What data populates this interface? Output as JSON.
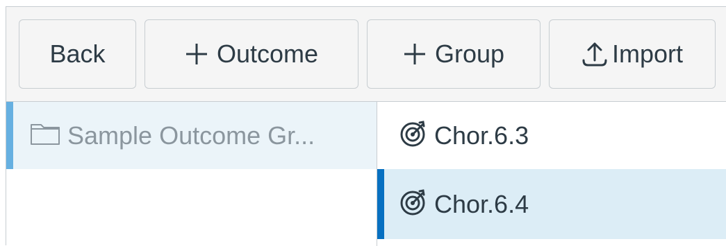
{
  "toolbar": {
    "back_label": "Back",
    "outcome_label": "Outcome",
    "group_label": "Group",
    "import_label": "Import"
  },
  "folders": [
    {
      "label": "Sample Outcome Gr...",
      "icon": "folder-icon",
      "selected": true
    }
  ],
  "outcomes": [
    {
      "label": "Chor.6.3",
      "icon": "target-icon",
      "selected": false
    },
    {
      "label": "Chor.6.4",
      "icon": "target-icon",
      "selected": true
    }
  ],
  "colors": {
    "toolbar_bg": "#f5f5f5",
    "text": "#2d3b45",
    "folder_text": "#8b969e",
    "folder_selected_bg": "#ebf4f9",
    "folder_indicator": "#66b0e1",
    "outcome_selected_bg": "#dcedf6",
    "outcome_indicator": "#0770c1"
  }
}
